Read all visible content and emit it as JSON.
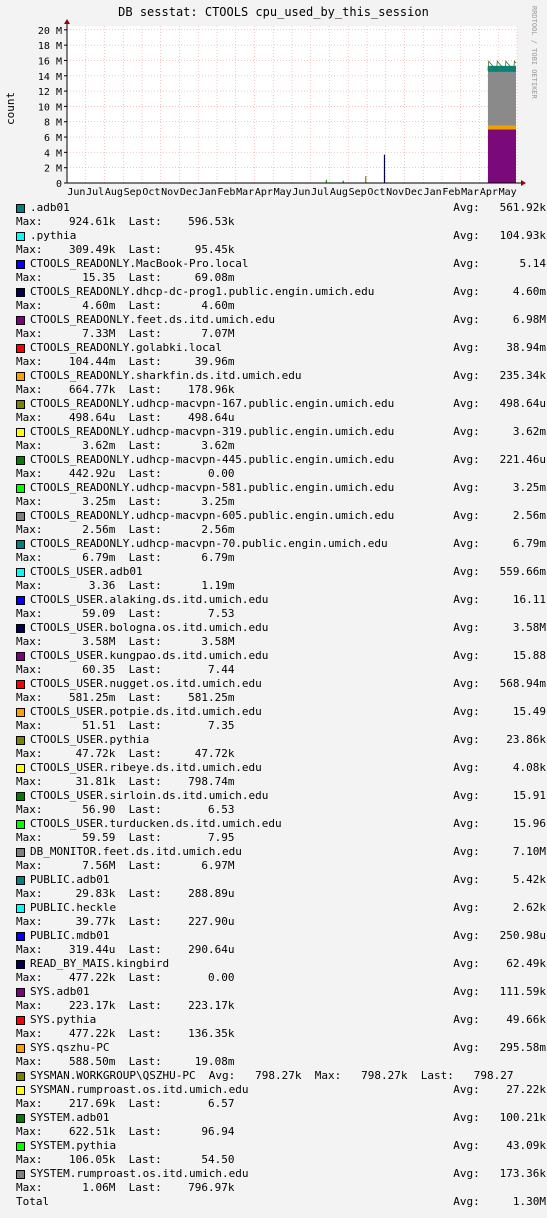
{
  "title": "DB sesstat: CTOOLS cpu_used_by_this_session",
  "side_note": "RRDTOOL / TOBI OETIKER",
  "chart_data": {
    "type": "area",
    "title": "DB sesstat: CTOOLS cpu_used_by_this_session",
    "ylabel": "count",
    "xlabel": "",
    "y_ticks": [
      "0",
      "2 M",
      "4 M",
      "6 M",
      "8 M",
      "10 M",
      "12 M",
      "14 M",
      "16 M",
      "18 M",
      "20 M"
    ],
    "ylim": [
      0,
      20500000
    ],
    "x_ticks": [
      "Jun",
      "Jul",
      "Aug",
      "Sep",
      "Oct",
      "Nov",
      "Dec",
      "Jan",
      "Feb",
      "Mar",
      "Apr",
      "May",
      "Jun",
      "Jul",
      "Aug",
      "Sep",
      "Oct",
      "Nov",
      "Dec",
      "Jan",
      "Feb",
      "Mar",
      "Apr",
      "May"
    ],
    "grid": true,
    "stacked_recent": [
      {
        "name": "CTOOLS_READONLY.feet.ds.itd.umich.edu",
        "color": "#7a0a7a",
        "approx_value": 7000000
      },
      {
        "name": "CTOOLS_READONLY.sharkfin.ds.itd.umich.edu",
        "color": "#f0a000",
        "approx_value": 500000
      },
      {
        "name": "DB_MONITOR.feet.ds.itd.umich.edu",
        "color": "#8a8a8a",
        "approx_value": 7000000
      },
      {
        "name": ".adb01",
        "color": "#0a8080",
        "approx_value": 800000
      }
    ],
    "spikes": [
      {
        "month_index": 13.8,
        "value": 400000,
        "color": "#00a000"
      },
      {
        "month_index": 14.7,
        "value": 300000,
        "color": "#00a000"
      },
      {
        "month_index": 16.9,
        "value": 3700000,
        "color": "#000050"
      },
      {
        "month_index": 15.9,
        "value": 900000,
        "color": "#808000"
      }
    ],
    "series": [
      {
        "name": ".adb01",
        "color": "#008080",
        "max": "924.61k",
        "last": "596.53k",
        "avg": "561.92k"
      },
      {
        "name": ".pythia",
        "color": "#00ffff",
        "max": "309.49k",
        "last": "95.45k",
        "avg": "104.93k"
      },
      {
        "name": "CTOOLS_READONLY.MacBook-Pro.local",
        "color": "#0000ff",
        "max": "15.35",
        "last": "69.08m",
        "avg": "5.14"
      },
      {
        "name": "CTOOLS_READONLY.dhcp-dc-prog1.public.engin.umich.edu",
        "color": "#000050",
        "max": "4.60m",
        "last": "4.60m",
        "avg": "4.60m"
      },
      {
        "name": "CTOOLS_READONLY.feet.ds.itd.umich.edu",
        "color": "#800080",
        "max": "7.33M",
        "last": "7.07M",
        "avg": "6.98M"
      },
      {
        "name": "CTOOLS_READONLY.golabki.local",
        "color": "#ff0000",
        "max": "104.44m",
        "last": "39.96m",
        "avg": "38.94m"
      },
      {
        "name": "CTOOLS_READONLY.sharkfin.ds.itd.umich.edu",
        "color": "#ffa000",
        "max": "664.77k",
        "last": "178.96k",
        "avg": "235.34k"
      },
      {
        "name": "CTOOLS_READONLY.udhcp-macvpn-167.public.engin.umich.edu",
        "color": "#808000",
        "max": "498.64u",
        "last": "498.64u",
        "avg": "498.64u"
      },
      {
        "name": "CTOOLS_READONLY.udhcp-macvpn-319.public.engin.umich.edu",
        "color": "#ffff00",
        "max": "3.62m",
        "last": "3.62m",
        "avg": "3.62m"
      },
      {
        "name": "CTOOLS_READONLY.udhcp-macvpn-445.public.engin.umich.edu",
        "color": "#008000",
        "max": "442.92u",
        "last": "0.00",
        "avg": "221.46u"
      },
      {
        "name": "CTOOLS_READONLY.udhcp-macvpn-581.public.engin.umich.edu",
        "color": "#00ff00",
        "max": "3.25m",
        "last": "3.25m",
        "avg": "3.25m"
      },
      {
        "name": "CTOOLS_READONLY.udhcp-macvpn-605.public.engin.umich.edu",
        "color": "#808080",
        "max": "2.56m",
        "last": "2.56m",
        "avg": "2.56m"
      },
      {
        "name": "CTOOLS_READONLY.udhcp-macvpn-70.public.engin.umich.edu",
        "color": "#008080",
        "max": "6.79m",
        "last": "6.79m",
        "avg": "6.79m"
      },
      {
        "name": "CTOOLS_USER.adb01",
        "color": "#00ffff",
        "max": "3.36",
        "last": "1.19m",
        "avg": "559.66m"
      },
      {
        "name": "CTOOLS_USER.alaking.ds.itd.umich.edu",
        "color": "#0000ff",
        "max": "59.09",
        "last": "7.53",
        "avg": "16.11"
      },
      {
        "name": "CTOOLS_USER.bologna.os.itd.umich.edu",
        "color": "#000050",
        "max": "3.58M",
        "last": "3.58M",
        "avg": "3.58M"
      },
      {
        "name": "CTOOLS_USER.kungpao.ds.itd.umich.edu",
        "color": "#800080",
        "max": "60.35",
        "last": "7.44",
        "avg": "15.88"
      },
      {
        "name": "CTOOLS_USER.nugget.os.itd.umich.edu",
        "color": "#ff0000",
        "max": "581.25m",
        "last": "581.25m",
        "avg": "568.94m"
      },
      {
        "name": "CTOOLS_USER.potpie.ds.itd.umich.edu",
        "color": "#ffa000",
        "max": "51.51",
        "last": "7.35",
        "avg": "15.49"
      },
      {
        "name": "CTOOLS_USER.pythia",
        "color": "#808000",
        "max": "47.72k",
        "last": "47.72k",
        "avg": "23.86k"
      },
      {
        "name": "CTOOLS_USER.ribeye.ds.itd.umich.edu",
        "color": "#ffff00",
        "max": "31.81k",
        "last": "798.74m",
        "avg": "4.08k"
      },
      {
        "name": "CTOOLS_USER.sirloin.ds.itd.umich.edu",
        "color": "#008000",
        "max": "56.90",
        "last": "6.53",
        "avg": "15.91"
      },
      {
        "name": "CTOOLS_USER.turducken.ds.itd.umich.edu",
        "color": "#00ff00",
        "max": "59.59",
        "last": "7.95",
        "avg": "15.96"
      },
      {
        "name": "DB_MONITOR.feet.ds.itd.umich.edu",
        "color": "#808080",
        "max": "7.56M",
        "last": "6.97M",
        "avg": "7.10M"
      },
      {
        "name": "PUBLIC.adb01",
        "color": "#008080",
        "max": "29.83k",
        "last": "288.89u",
        "avg": "5.42k"
      },
      {
        "name": "PUBLIC.heckle",
        "color": "#00ffff",
        "max": "39.77k",
        "last": "227.90u",
        "avg": "2.62k"
      },
      {
        "name": "PUBLIC.mdb01",
        "color": "#0000ff",
        "max": "319.44u",
        "last": "290.64u",
        "avg": "250.98u"
      },
      {
        "name": "READ_BY_MAIS.kingbird",
        "color": "#000050",
        "max": "477.22k",
        "last": "0.00",
        "avg": "62.49k"
      },
      {
        "name": "SYS.adb01",
        "color": "#800080",
        "max": "223.17k",
        "last": "223.17k",
        "avg": "111.59k"
      },
      {
        "name": "SYS.pythia",
        "color": "#ff0000",
        "max": "477.22k",
        "last": "136.35k",
        "avg": "49.66k"
      },
      {
        "name": "SYS.qszhu-PC",
        "color": "#ffa000",
        "max": "588.50m",
        "last": "19.08m",
        "avg": "295.58m"
      },
      {
        "name": "SYSMAN.WORKGROUP\\QSZHU-PC",
        "color": "#808000",
        "max": "798.27k",
        "last": "798.27",
        "avg": "798.27k",
        "inline": true
      },
      {
        "name": "SYSMAN.rumproast.os.itd.umich.edu",
        "color": "#ffff00",
        "max": "217.69k",
        "last": "6.57",
        "avg": "27.22k"
      },
      {
        "name": "SYSTEM.adb01",
        "color": "#008000",
        "max": "622.51k",
        "last": "96.94",
        "avg": "100.21k"
      },
      {
        "name": "SYSTEM.pythia",
        "color": "#00ff00",
        "max": "106.05k",
        "last": "54.50",
        "avg": "43.09k"
      },
      {
        "name": "SYSTEM.rumproast.os.itd.umich.edu",
        "color": "#808080",
        "max": "1.06M",
        "last": "796.97k",
        "avg": "173.36k"
      }
    ],
    "total": {
      "label": "Total",
      "avg": "1.30M"
    }
  },
  "labels": {
    "max": "Max:",
    "last": "Last:",
    "avg": "Avg:"
  }
}
